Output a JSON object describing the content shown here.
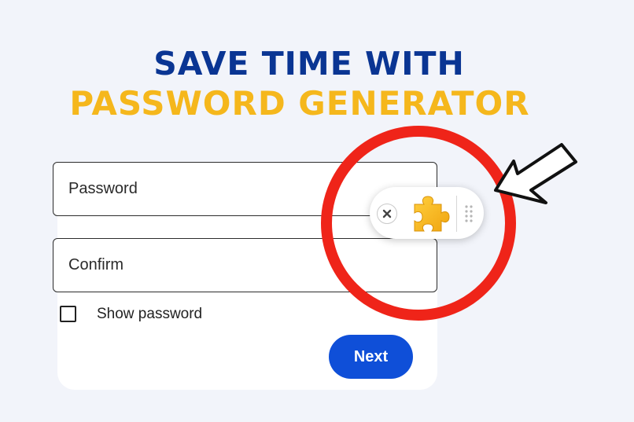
{
  "headline": {
    "line1": "SAVE TIME WITH",
    "line2": "PASSWORD GENERATOR"
  },
  "form": {
    "password_placeholder": "Password",
    "confirm_placeholder": "Confirm",
    "show_password_label": "Show password",
    "show_password_checked": false,
    "next_label": "Next"
  },
  "extension_popup": {
    "close_icon": "close-icon",
    "extension_icon": "puzzle-piece-icon",
    "drag_icon": "drag-handle-icon"
  },
  "colors": {
    "background": "#f2f4fa",
    "headline_primary": "#0a3593",
    "headline_accent": "#f5b71c",
    "button": "#0f4fd8",
    "highlight_ring": "#ef2419",
    "puzzle": "#f5b41c"
  }
}
